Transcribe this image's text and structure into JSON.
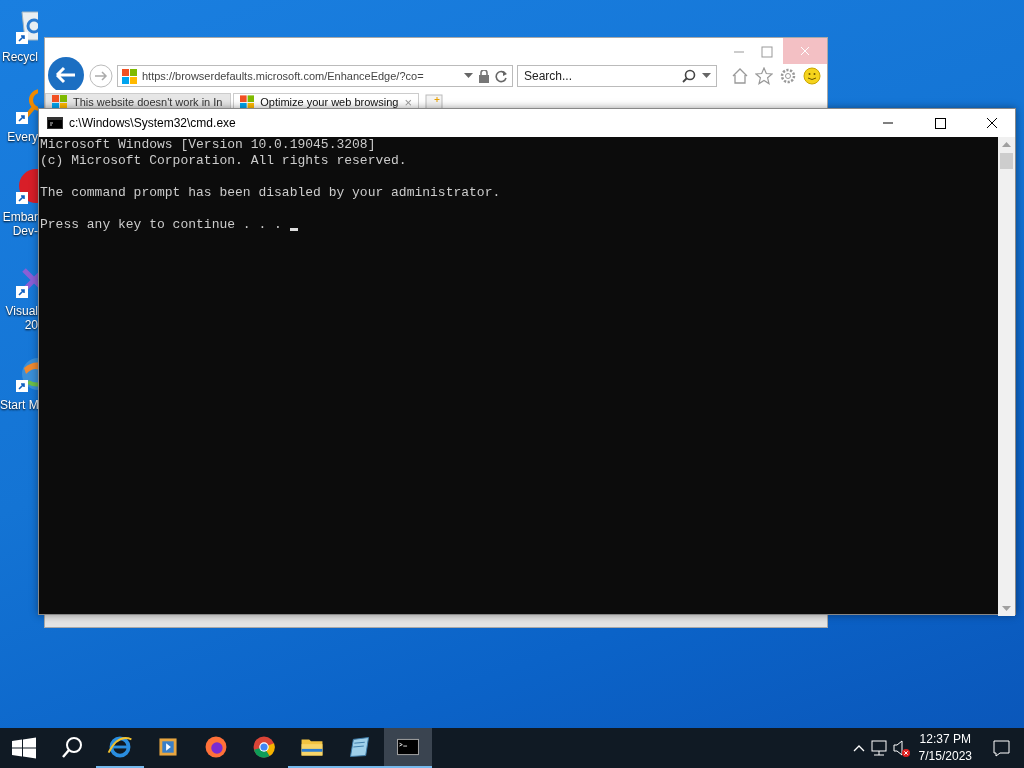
{
  "desktop_icons": [
    {
      "kind": "recycle",
      "lines": [
        "Recycl"
      ]
    },
    {
      "kind": "magnifier",
      "lines": [
        "Every"
      ]
    },
    {
      "kind": "red-app",
      "lines": [
        "Embar",
        "Dev-"
      ]
    },
    {
      "kind": "studio",
      "lines": [
        "Visual",
        "20"
      ]
    },
    {
      "kind": "globe",
      "lines": [
        "Start M"
      ]
    }
  ],
  "browser": {
    "address": "https://browserdefaults.microsoft.com/EnhanceEdge/?co=",
    "search": {
      "placeholder": "Search..."
    },
    "tabs": [
      {
        "label": "This website doesn't work in In",
        "selected": false
      },
      {
        "label": "Optimize your web browsing",
        "selected": true
      }
    ],
    "tab_close": "×"
  },
  "console": {
    "title": "c:\\Windows\\System32\\cmd.exe",
    "blocks": [
      [
        "Microsoft Windows [Version 10.0.19045.3208]",
        "(c) Microsoft Corporation. All rights reserved."
      ],
      [
        "The command prompt has been disabled by your administrator."
      ],
      [
        "Press any key to continue . . . "
      ]
    ],
    "cursor_visible": true
  },
  "taskbar": {
    "apps": [
      {
        "kind": "ie",
        "running": true,
        "active": false
      },
      {
        "kind": "media",
        "running": false,
        "active": false
      },
      {
        "kind": "firefox",
        "running": false,
        "active": false
      },
      {
        "kind": "chrome",
        "running": false,
        "active": false
      },
      {
        "kind": "folder",
        "running": true,
        "active": false
      },
      {
        "kind": "notepad",
        "running": true,
        "active": false
      },
      {
        "kind": "console",
        "running": true,
        "active": true
      }
    ],
    "volume_muted": true,
    "time": "12:37 PM",
    "date": "7/15/2023"
  }
}
